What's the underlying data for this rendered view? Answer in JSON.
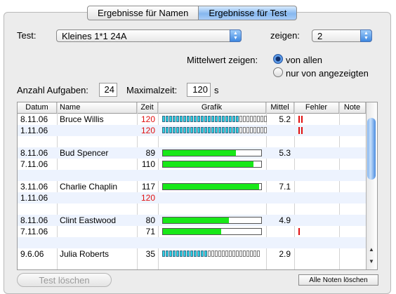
{
  "tabs": [
    "Ergebnisse für Namen",
    "Ergebnisse für Test"
  ],
  "test": {
    "label": "Test:",
    "value": "Kleines 1*1 24A"
  },
  "zeigen": {
    "label": "zeigen:",
    "value": "2"
  },
  "mittelwert": {
    "label": "Mittelwert zeigen:",
    "option1": "von allen",
    "option2": "nur von angezeigten",
    "selected": "von allen"
  },
  "anzahl": {
    "label": "Anzahl Aufgaben:",
    "value": "24"
  },
  "maxzeit": {
    "label": "Maximalzeit:",
    "value": "120",
    "unit": "s"
  },
  "columns": [
    "Datum",
    "Name",
    "Zeit",
    "Grafik",
    "Mittel",
    "Fehler",
    "Note"
  ],
  "rows": [
    {
      "datum": "8.11.06",
      "name": "Bruce Willis",
      "zeit": "120",
      "mittel": "5.2",
      "red": true,
      "grafik": "segments",
      "solved": 22,
      "total": 30,
      "errors": 2
    },
    {
      "datum": "1.11.06",
      "name": "",
      "zeit": "120",
      "mittel": "",
      "red": true,
      "grafik": "segments",
      "solved": 22,
      "total": 30,
      "errors": 2
    },
    {
      "datum": "",
      "name": "",
      "zeit": "",
      "mittel": "",
      "grafik": "none"
    },
    {
      "datum": "8.11.06",
      "name": "Bud Spencer",
      "zeit": "89",
      "mittel": "5.3",
      "grafik": "bar",
      "fraction": 0.74
    },
    {
      "datum": "7.11.06",
      "name": "",
      "zeit": "110",
      "mittel": "",
      "grafik": "bar",
      "fraction": 0.92
    },
    {
      "datum": "",
      "name": "",
      "zeit": "",
      "mittel": "",
      "grafik": "none"
    },
    {
      "datum": "3.11.06",
      "name": "Charlie Chaplin",
      "zeit": "117",
      "mittel": "7.1",
      "grafik": "bar",
      "fraction": 0.98
    },
    {
      "datum": "1.11.06",
      "name": "",
      "zeit": "120",
      "mittel": "",
      "red": true,
      "grafik": "none"
    },
    {
      "datum": "",
      "name": "",
      "zeit": "",
      "mittel": "",
      "grafik": "none"
    },
    {
      "datum": "8.11.06",
      "name": "Clint Eastwood",
      "zeit": "80",
      "mittel": "4.9",
      "grafik": "bar",
      "fraction": 0.67
    },
    {
      "datum": "7.11.06",
      "name": "",
      "zeit": "71",
      "mittel": "",
      "grafik": "bar",
      "fraction": 0.59,
      "errors": 1
    },
    {
      "datum": "",
      "name": "",
      "zeit": "",
      "mittel": "",
      "grafik": "none"
    },
    {
      "datum": "9.6.06",
      "name": "Julia Roberts",
      "zeit": "35",
      "mittel": "2.9",
      "grafik": "segments",
      "solved": 13,
      "total": 28
    }
  ],
  "buttons": {
    "test_loeschen": "Test löschen",
    "alle_noten": "Alle Noten löschen"
  }
}
